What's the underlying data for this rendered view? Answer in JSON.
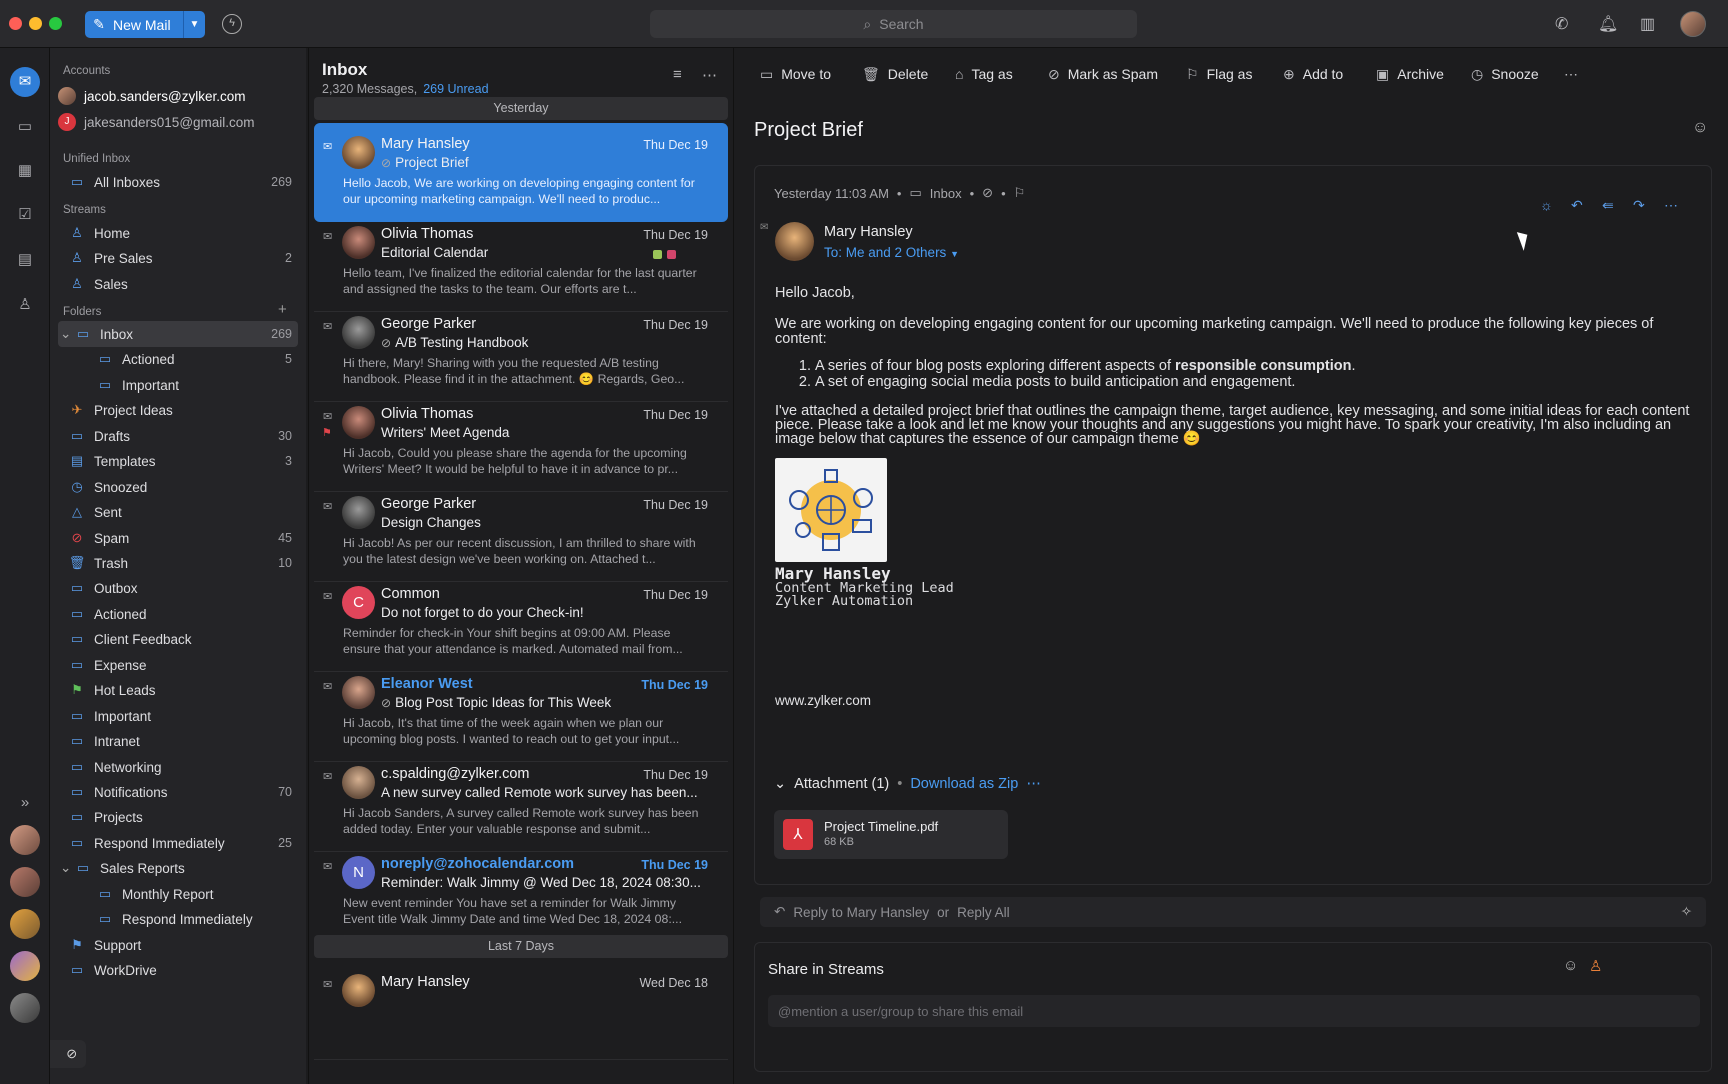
{
  "titlebar": {
    "new_mail": "New Mail",
    "search_placeholder": "Search"
  },
  "sidebar": {
    "accounts_head": "Accounts",
    "accounts": [
      "jacob.sanders@zylker.com",
      "jakesanders015@gmail.com"
    ],
    "unified_head": "Unified Inbox",
    "all_inboxes": {
      "label": "All Inboxes",
      "count": "269"
    },
    "streams_head": "Streams",
    "streams": [
      {
        "label": "Home",
        "count": ""
      },
      {
        "label": "Pre Sales",
        "count": "2"
      },
      {
        "label": "Sales",
        "count": ""
      }
    ],
    "folders_head": "Folders",
    "folders": [
      {
        "label": "Inbox",
        "count": "269"
      },
      {
        "label": "Actioned",
        "count": "5"
      },
      {
        "label": "Important",
        "count": ""
      },
      {
        "label": "Project Ideas",
        "count": ""
      },
      {
        "label": "Drafts",
        "count": "30"
      },
      {
        "label": "Templates",
        "count": "3"
      },
      {
        "label": "Snoozed",
        "count": ""
      },
      {
        "label": "Sent",
        "count": ""
      },
      {
        "label": "Spam",
        "count": "45"
      },
      {
        "label": "Trash",
        "count": "10"
      },
      {
        "label": "Outbox",
        "count": ""
      },
      {
        "label": "Actioned",
        "count": ""
      },
      {
        "label": "Client Feedback",
        "count": ""
      },
      {
        "label": "Expense",
        "count": ""
      },
      {
        "label": "Hot Leads",
        "count": ""
      },
      {
        "label": "Important",
        "count": ""
      },
      {
        "label": "Intranet",
        "count": ""
      },
      {
        "label": "Networking",
        "count": ""
      },
      {
        "label": "Notifications",
        "count": "70"
      },
      {
        "label": "Projects",
        "count": ""
      },
      {
        "label": "Respond Immediately",
        "count": "25"
      },
      {
        "label": "Sales Reports",
        "count": ""
      },
      {
        "label": "Monthly Report",
        "count": ""
      },
      {
        "label": "Respond Immediately",
        "count": ""
      },
      {
        "label": "Support",
        "count": ""
      },
      {
        "label": "WorkDrive",
        "count": ""
      }
    ]
  },
  "list": {
    "title": "Inbox",
    "messages_count": "2,320 Messages,",
    "unread": "269 Unread",
    "sep_yesterday": "Yesterday",
    "sep_last7": "Last 7 Days",
    "messages": [
      {
        "from": "Mary Hansley",
        "date": "Thu Dec 19",
        "subject": "Project Brief",
        "preview": "Hello Jacob, We are working on developing engaging content for our upcoming marketing campaign. We'll need to produc..."
      },
      {
        "from": "Olivia Thomas",
        "date": "Thu Dec 19",
        "subject": "Editorial Calendar",
        "preview": "Hello team, I've finalized the editorial calendar for the last quarter and assigned the tasks to the team. Our efforts are t..."
      },
      {
        "from": "George Parker",
        "date": "Thu Dec 19",
        "subject": "A/B Testing Handbook",
        "preview": "Hi there, Mary! Sharing with you the requested A/B testing handbook. Please find it in the attachment. 😊 Regards, Geo..."
      },
      {
        "from": "Olivia Thomas",
        "date": "Thu Dec 19",
        "subject": "Writers' Meet Agenda",
        "preview": "Hi Jacob, Could you please share the agenda for the upcoming Writers' Meet? It would be helpful to have it in advance to pr..."
      },
      {
        "from": "George Parker",
        "date": "Thu Dec 19",
        "subject": "Design Changes",
        "preview": "Hi Jacob! As per our recent discussion, I am thrilled to share with you the latest design we've been working on. Attached t..."
      },
      {
        "from": "Common",
        "date": "Thu Dec 19",
        "subject": "Do not forget to do your Check-in!",
        "preview": "Reminder for check-in Your shift begins at 09:00 AM. Please ensure that your attendance is marked. Automated mail from..."
      },
      {
        "from": "Eleanor West",
        "date": "Thu Dec 19",
        "subject": "Blog Post Topic Ideas for This Week",
        "preview": "Hi Jacob, It's that time of the week again when we plan our upcoming blog posts. I wanted to reach out to get your input..."
      },
      {
        "from": "c.spalding@zylker.com",
        "date": "Thu Dec 19",
        "subject": "A new survey called Remote work survey has been...",
        "preview": "Hi Jacob Sanders, A survey called Remote work survey has been added today. Enter your valuable response and submit..."
      },
      {
        "from": "noreply@zohocalendar.com",
        "date": "Thu Dec 19",
        "subject": "Reminder: Walk Jimmy @ Wed Dec 18, 2024 08:30...",
        "preview": "New event reminder You have set a reminder for Walk Jimmy Event title Walk Jimmy Date and time Wed Dec 18, 2024 08:..."
      },
      {
        "from": "Mary Hansley",
        "date": "Wed Dec 18",
        "subject": "",
        "preview": ""
      }
    ],
    "common_initial": "C",
    "noreply_initial": "N"
  },
  "reader": {
    "toolbar": [
      "Move to",
      "Delete",
      "Tag as",
      "Mark as Spam",
      "Flag as",
      "Add to",
      "Archive",
      "Snooze"
    ],
    "title": "Project Brief",
    "meta_time": "Yesterday 11:03 AM",
    "meta_folder": "Inbox",
    "sender": "Mary Hansley",
    "to": "To: Me and 2 Others",
    "greeting": "Hello Jacob,",
    "para1": "We are working on developing engaging content for our upcoming marketing campaign. We'll need to produce the following key pieces of content:",
    "item1_pre": "A series of four blog posts exploring different aspects of ",
    "item1_bold": "responsible consumption",
    "item1_post": ".",
    "item2": "A set of engaging social media posts to build anticipation and engagement.",
    "para2": "I've attached a detailed project brief that outlines the campaign theme, target audience, key messaging, and some initial ideas for each content piece. Please take a look and let me know your thoughts and any suggestions you might have. To spark your creativity, I'm also including an image below that captures the essence of our campaign theme 😊",
    "sig_name": "Mary Hansley",
    "sig_role": "Content Marketing Lead",
    "sig_company": "Zylker Automation",
    "website": "www.zylker.com",
    "attachment_head": "Attachment (1)",
    "download_zip": "Download as Zip",
    "file_name": "Project Timeline.pdf",
    "file_size": "68 KB",
    "reply_text": "Reply to Mary Hansley",
    "reply_or": "or",
    "reply_all": "Reply All",
    "share_title": "Share in Streams",
    "share_placeholder": "@mention a user/group to share this email"
  }
}
